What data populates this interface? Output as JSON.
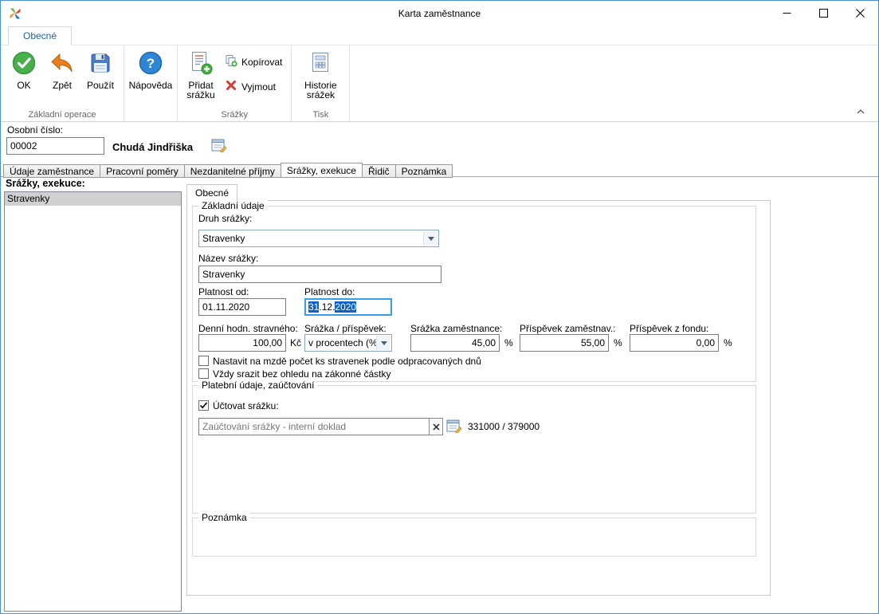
{
  "window": {
    "title": "Karta zaměstnance"
  },
  "ribbon": {
    "tab_label": "Obecné",
    "basic_group": {
      "label": "Základní operace",
      "ok": "OK",
      "back": "Zpět",
      "apply": "Použít"
    },
    "help_button": "Nápověda",
    "deductions_group": {
      "label": "Srážky",
      "add": "Přidat srážku",
      "copy": "Kopírovat",
      "cut": "Vyjmout"
    },
    "print_group": {
      "label": "Tisk",
      "history": "Historie srážek"
    }
  },
  "employee_header": {
    "personal_number_label": "Osobní číslo:",
    "personal_number": "00002",
    "name": "Chudá Jindřiška"
  },
  "tabs": {
    "items": [
      "Údaje zaměstnance",
      "Pracovní poměry",
      "Nezdanitelné příjmy",
      "Srážky, exekuce",
      "Řidič",
      "Poznámka"
    ],
    "active": "Srážky, exekuce"
  },
  "deductions_panel": {
    "title": "Srážky, exekuce:",
    "selected_item": "Stravenky"
  },
  "detail": {
    "tab_label": "Obecné",
    "basic": {
      "title": "Základní údaje",
      "type_label": "Druh srážky:",
      "type_value": "Stravenky",
      "name_label": "Název srážky:",
      "name_value": "Stravenky",
      "valid_from_label": "Platnost od:",
      "valid_from": "01.11.2020",
      "valid_to_label": "Platnost do:",
      "valid_to": {
        "day": "31",
        "dot": ".",
        "month": "12",
        "year": "2020"
      },
      "daily_value_label": "Denní hodn. stravného:",
      "daily_value": "100,00",
      "currency_unit": "Kč",
      "mode_label": "Srážka / příspěvek:",
      "mode_value": "v procentech (%)",
      "employee_deduction_label": "Srážka zaměstnance:",
      "employee_deduction": "45,00",
      "employer_contribution_label": "Příspěvek zaměstnav.:",
      "employer_contribution": "55,00",
      "fund_contribution_label": "Příspěvek z fondu:",
      "fund_contribution": "0,00",
      "percent_unit": "%",
      "checkbox_meal_count": "Nastavit na mzdě počet ks stravenek podle odpracovaných dnů",
      "checkbox_always_deduct": "Vždy srazit bez ohledu na zákonné částky"
    },
    "payment": {
      "title": "Platební údaje, zaúčtování",
      "account_checkbox": "Účtovat srážku:",
      "posting_value": "Zaúčtování srážky - interní doklad",
      "accounts": "331000 / 379000"
    },
    "note": {
      "title": "Poznámka"
    }
  }
}
